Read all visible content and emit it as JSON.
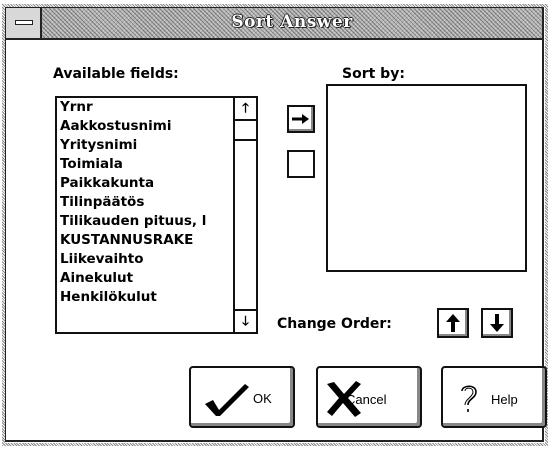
{
  "window": {
    "title": "Sort Answer"
  },
  "available_fields": {
    "label": "Available fields:",
    "items": [
      "Yrnr",
      "Aakkostusnimi",
      "Yritysnimi",
      "Toimiala",
      "Paikkakunta",
      "Tilinpäätös",
      "Tilikauden pituus, l",
      "KUSTANNUSRAKE",
      "Liikevaihto",
      "Ainekulut",
      "Henkilökulut"
    ],
    "scroll_up": "🡑",
    "scroll_down": "🡓"
  },
  "sort_by": {
    "label": "Sort by:",
    "items": []
  },
  "move_buttons": {
    "add_glyph": "→",
    "remove_glyph": ""
  },
  "change_order": {
    "label": "Change Order:",
    "up_glyph": "🡑",
    "down_glyph": "🡓"
  },
  "buttons": {
    "ok": "OK",
    "cancel": "Cancel",
    "help": "Help"
  },
  "icons": {
    "ok": "checkmark-icon",
    "cancel": "x-icon",
    "help": "question-icon"
  }
}
